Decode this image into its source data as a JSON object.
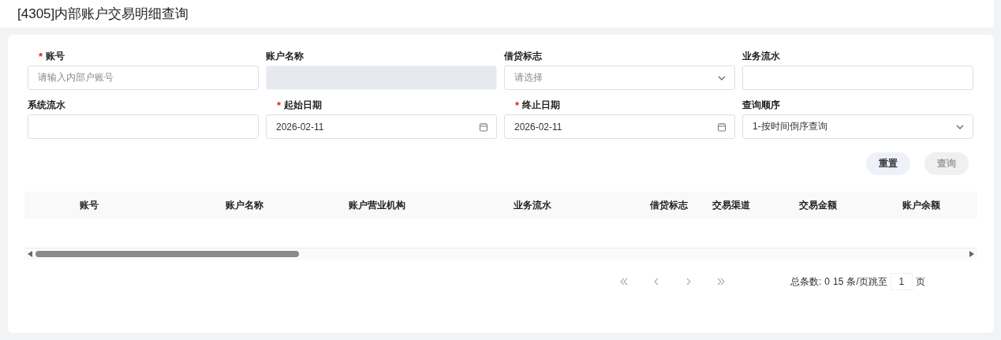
{
  "page_title": "[4305]内部账户交易明细查询",
  "form": {
    "required_mark": "*",
    "fields": [
      {
        "kind": "text",
        "label": "账号",
        "required": true,
        "placeholder": "请输入内部户账号",
        "disabled": false
      },
      {
        "kind": "text",
        "label": "账户名称",
        "required": false,
        "disabled": true
      },
      {
        "kind": "select",
        "label": "借贷标志",
        "required": false,
        "placeholder": "请选择",
        "disabled": false
      },
      {
        "kind": "text",
        "label": "业务流水",
        "required": false,
        "disabled": false
      },
      {
        "kind": "text",
        "label": "系统流水",
        "required": false,
        "disabled": false
      },
      {
        "kind": "date",
        "label": "起始日期",
        "required": true,
        "value": "2026-02-11",
        "disabled": false
      },
      {
        "kind": "date",
        "label": "终止日期",
        "required": true,
        "value": "2026-02-11",
        "disabled": false
      },
      {
        "kind": "select",
        "label": "查询顺序",
        "required": false,
        "value": "1-按时间倒序查询",
        "disabled": false
      }
    ]
  },
  "buttons": [
    {
      "label": "重置",
      "disabled": false
    },
    {
      "label": "查询",
      "disabled": true
    }
  ],
  "table": {
    "columns": [
      "账号",
      "账户名称",
      "账户营业机构",
      "业务流水",
      "借贷标志",
      "交易渠道",
      "交易金额",
      "账户余额"
    ]
  },
  "pagination": {
    "total_label": "总条数:",
    "total": "0",
    "page_size": "15",
    "page_size_label": "条/页跳至",
    "page": "1",
    "page_label": "页"
  }
}
